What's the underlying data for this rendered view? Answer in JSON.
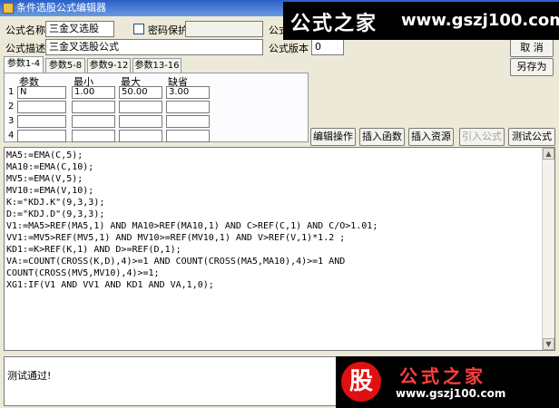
{
  "window": {
    "title": "条件选股公式编辑器"
  },
  "form": {
    "name_label": "公式名称",
    "name_value": "三金叉选股",
    "password_label": "密码保护",
    "desc_label": "公式描述",
    "desc_value": "三金叉选股公式",
    "version_label": "公式版本",
    "version_value": "0",
    "formula_label": "公式"
  },
  "buttons": {
    "cancel": "取 消",
    "save_as": "另存为",
    "edit_op": "编辑操作",
    "insert_func": "插入函数",
    "insert_res": "插入资源",
    "import": "引入公式",
    "test": "测试公式"
  },
  "tabs": [
    "参数1-4",
    "参数5-8",
    "参数9-12",
    "参数13-16"
  ],
  "params": {
    "headers": [
      "参数",
      "最小",
      "最大",
      "缺省"
    ],
    "rows": [
      {
        "num": "1",
        "name": "N",
        "min": "1.00",
        "max": "50.00",
        "def": "3.00"
      },
      {
        "num": "2",
        "name": "",
        "min": "",
        "max": "",
        "def": ""
      },
      {
        "num": "3",
        "name": "",
        "min": "",
        "max": "",
        "def": ""
      },
      {
        "num": "4",
        "name": "",
        "min": "",
        "max": "",
        "def": ""
      }
    ]
  },
  "code": [
    "MA5:=EMA(C,5);",
    "MA10:=EMA(C,10);",
    "MV5:=EMA(V,5);",
    "MV10:=EMA(V,10);",
    "K:=\"KDJ.K\"(9,3,3);",
    "D:=\"KDJ.D\"(9,3,3);",
    "V1:=MA5>REF(MA5,1) AND MA10>REF(MA10,1) AND C>REF(C,1) AND C/O>1.01;",
    "VV1:=MV5>REF(MV5,1) AND MV10>=REF(MV10,1) AND V>REF(V,1)*1.2 ;",
    "KD1:=K>REF(K,1) AND D>=REF(D,1);",
    "VA:=COUNT(CROSS(K,D),4)>=1 AND COUNT(CROSS(MA5,MA10),4)>=1 AND",
    "COUNT(CROSS(MV5,MV10),4)>=1;",
    "XG1:IF(V1 AND VV1 AND KD1 AND VA,1,0);"
  ],
  "status": {
    "text": "测试通过!"
  },
  "watermark": {
    "top_title": "公式之家",
    "top_url": "www.gszj100.com",
    "bot_stamp": "股",
    "bot_title": "公式之家",
    "bot_url": "www.gszj100.com"
  }
}
